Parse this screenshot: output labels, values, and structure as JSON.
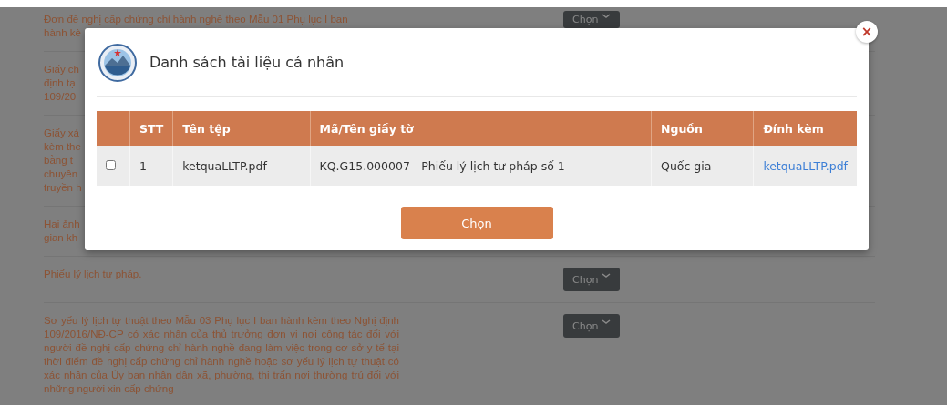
{
  "background_items": [
    {
      "lines": [
        "Đơn đề nghị cấp chứng chỉ hành nghề theo Mẫu 01 Phụ lục I ban",
        "hành kè"
      ],
      "button": {
        "label": "Chọn"
      }
    },
    {
      "lines": [
        "Giấy ch",
        "định tạ",
        "109/20"
      ]
    },
    {
      "lines": [
        "Giấy xá",
        "kèm the",
        "bằng t",
        "chuyên",
        "truyền h"
      ]
    },
    {
      "lines": [
        "Hai ảnh",
        "gian kh"
      ]
    },
    {
      "lines": [
        "Phiếu lý lịch tư pháp."
      ],
      "button": {
        "label": "Chọn"
      }
    },
    {
      "paragraph": "Sơ yếu lý lịch tự thuật theo Mẫu 03 Phụ lục I ban hành kèm theo Nghị định 109/2016/NĐ-CP có xác nhận của thủ trưởng đơn vị nơi công tác đối với người đề nghị cấp chứng chỉ hành nghề đang làm việc trong cơ sở y tế tại thời điểm đề nghị cấp chứng chỉ hành nghề hoặc sơ yếu lý lịch tự thuật có xác nhận của Ủy ban nhân dân xã, phường, thị trấn nơi thường trú đối với những người xin cấp chứng",
      "button": {
        "label": "Chọn"
      }
    }
  ],
  "modal": {
    "title": "Danh sách tài liệu cá nhân",
    "close": "×",
    "table": {
      "columns": [
        "STT",
        "Tên tệp",
        "Mã/Tên giấy tờ",
        "Nguồn",
        "Đính kèm"
      ],
      "rows": [
        {
          "checked": false,
          "stt": "1",
          "file_name": "ketquaLLTP.pdf",
          "document": "KQ.G15.000007 - Phiếu lý lịch tư pháp số 1",
          "source": "Quốc gia",
          "attachment": "ketquaLLTP.pdf"
        }
      ]
    },
    "button": "Chọn"
  }
}
